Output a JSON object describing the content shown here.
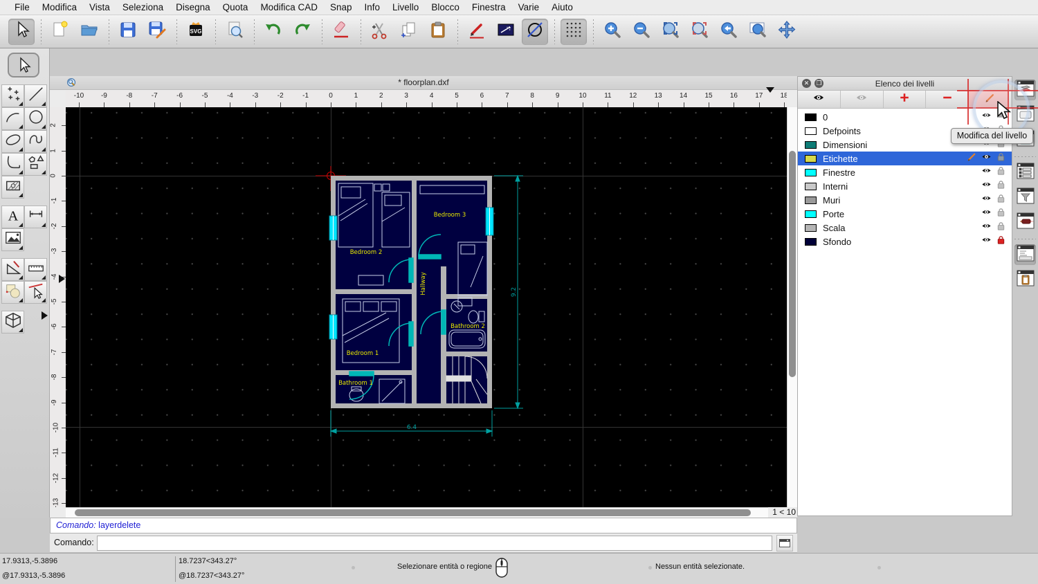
{
  "menu": {
    "items": [
      "File",
      "Modifica",
      "Vista",
      "Seleziona",
      "Disegna",
      "Quota",
      "Modifica CAD",
      "Snap",
      "Info",
      "Livello",
      "Blocco",
      "Finestra",
      "Varie",
      "Aiuto"
    ]
  },
  "toolbar": {
    "groups": [
      [
        "select"
      ],
      [
        "new-file",
        "open-file"
      ],
      [
        "save",
        "save-as"
      ],
      [
        "svg-export"
      ],
      [
        "print-preview"
      ],
      [
        "undo",
        "redo"
      ],
      [
        "delete-entity"
      ],
      [
        "cut",
        "copy",
        "paste"
      ],
      [
        "edit-pencil",
        "edit-attributes",
        "draft-mode"
      ],
      [
        "grid-toggle"
      ],
      [
        "zoom-in",
        "zoom-out",
        "zoom-auto",
        "zoom-select",
        "zoom-prev",
        "zoom-window",
        "zoom-pan"
      ]
    ],
    "pressed": [
      "select",
      "draft-mode",
      "grid-toggle"
    ]
  },
  "left_tools": {
    "rows": [
      [
        "points",
        "line"
      ],
      [
        "arc",
        "circle"
      ],
      [
        "ellipse",
        "spline"
      ],
      [
        "polyline",
        "polygon"
      ],
      [
        "hatch",
        null
      ],
      [
        "text",
        "dimension"
      ],
      [
        "image",
        null
      ],
      [
        "modify",
        "measure"
      ],
      [
        "block",
        "select-entity"
      ],
      [
        "solid-3d",
        null
      ]
    ]
  },
  "document": {
    "title": "* floorplan.dxf",
    "zoom_indicator": "1 < 10"
  },
  "rulers": {
    "horizontal": [
      -10,
      -9,
      -8,
      -7,
      -6,
      -5,
      -4,
      -3,
      -2,
      -1,
      0,
      1,
      2,
      3,
      4,
      5,
      6,
      7,
      8,
      9,
      10,
      11,
      12,
      13,
      14,
      15,
      16,
      17,
      18
    ],
    "vertical": [
      2,
      1,
      0,
      -1,
      -2,
      -3,
      -4,
      -5,
      -6,
      -7,
      -8,
      -9,
      -10,
      -11,
      -12,
      -13
    ]
  },
  "floorplan": {
    "labels": {
      "bedroom1": "Bedroom 1",
      "bedroom2": "Bedroom 2",
      "bedroom3": "Bedroom 3",
      "bathroom1": "Bathroom 1",
      "bathroom2": "Bathroom 2",
      "hallway": "Hallway"
    },
    "dimensions": {
      "width": "6.4",
      "height": "9.2"
    }
  },
  "layers_panel": {
    "title": "Elenco dei livelli",
    "tooltip": "Modifica del livello",
    "toolbar": [
      "show-all",
      "hide-all",
      "add-layer",
      "remove-layer",
      "edit-layer"
    ],
    "layers": [
      {
        "name": "0",
        "color": "#000000",
        "selected": false,
        "current": false,
        "lock": "none",
        "scroll_arrow": true
      },
      {
        "name": "Defpoints",
        "color": "#ffffff",
        "selected": false,
        "current": false,
        "lock": "gray"
      },
      {
        "name": "Dimensioni",
        "color": "#0e7c76",
        "selected": false,
        "current": false,
        "lock": "gray"
      },
      {
        "name": "Etichette",
        "color": "#d6d94b",
        "selected": true,
        "current": true,
        "lock": "dark"
      },
      {
        "name": "Finestre",
        "color": "#00ffff",
        "selected": false,
        "current": false,
        "lock": "gray"
      },
      {
        "name": "Interni",
        "color": "#c9c9c9",
        "selected": false,
        "current": false,
        "lock": "gray"
      },
      {
        "name": "Muri",
        "color": "#9a9a9a",
        "selected": false,
        "current": false,
        "lock": "gray"
      },
      {
        "name": "Porte",
        "color": "#00ffff",
        "selected": false,
        "current": false,
        "lock": "gray"
      },
      {
        "name": "Scala",
        "color": "#b5b5b5",
        "selected": false,
        "current": false,
        "lock": "gray"
      },
      {
        "name": "Sfondo",
        "color": "#000038",
        "selected": false,
        "current": false,
        "lock": "red"
      }
    ]
  },
  "right_dock": {
    "icons": [
      "dock-layers",
      "dock-levels",
      "dock-library",
      "sep",
      "dock-blocks",
      "dock-filter",
      "dock-pen",
      "sep",
      "dock-command",
      "dock-clipboard"
    ],
    "pressed": [
      "dock-layers",
      "dock-command"
    ]
  },
  "command": {
    "history_label": "Comando:",
    "history_value": "layerdelete",
    "prompt_label": "Comando:",
    "input_value": ""
  },
  "statusbar": {
    "abs": "17.9313,-5.3896",
    "abs_rel": "@17.9313,-5.3896",
    "polar": "18.7237<343.27°",
    "polar_rel": "@18.7237<343.27°",
    "hint": "Selezionare entità o regione",
    "selection": "Nessun entità selezionate."
  },
  "colors": {
    "selection_blue": "#2e66d9",
    "room_fill": "#000040",
    "wall_gray": "#b3b3b3",
    "label_yellow": "#e8e800",
    "door_cyan": "#00b6b6",
    "window_cyan": "#00e5ff",
    "dimension_teal": "#00a0a0",
    "origin_red": "#cc0000"
  }
}
